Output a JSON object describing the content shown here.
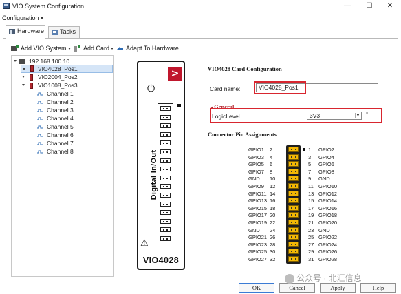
{
  "window": {
    "title": "VIO System Configuration",
    "minimize": "—",
    "maximize": "☐",
    "close": "✕"
  },
  "menu": {
    "configuration": "Configuration"
  },
  "tabs": [
    {
      "label": "Hardware"
    },
    {
      "label": "Tasks"
    }
  ],
  "toolbar": {
    "add_vio_system": "Add VIO System",
    "add_card": "Add Card",
    "adapt": "Adapt To Hardware..."
  },
  "tree": {
    "host": "192.168.100.10",
    "cards": [
      "VIO4028_Pos1",
      "VIO2004_Pos2",
      "VIO1008_Pos3"
    ],
    "channels": [
      "Channel 1",
      "Channel 2",
      "Channel 3",
      "Channel 4",
      "Channel 5",
      "Channel 6",
      "Channel 7",
      "Channel 8"
    ]
  },
  "card_graphic": {
    "label": "Digital In/Out",
    "model": "VIO4028",
    "logo": ">",
    "power": "⏻",
    "warning": "⚠"
  },
  "config": {
    "title": "VIO4028 Card Configuration",
    "card_name_label": "Card name:",
    "card_name_value": "VIO4028_Pos1",
    "general_title": "General",
    "logic_level_label": "LogicLevel",
    "logic_level_value": "3V3",
    "reset_glyph": "¤"
  },
  "pins": {
    "title": "Connector Pin Assignments",
    "rows": [
      {
        "left_name": "GPIO1",
        "left_num": "2",
        "right_num": "1",
        "right_name": "GPIO2"
      },
      {
        "left_name": "GPIO3",
        "left_num": "4",
        "right_num": "3",
        "right_name": "GPIO4"
      },
      {
        "left_name": "GPIO5",
        "left_num": "6",
        "right_num": "5",
        "right_name": "GPIO6"
      },
      {
        "left_name": "GPIO7",
        "left_num": "8",
        "right_num": "7",
        "right_name": "GPIO8"
      },
      {
        "left_name": "GND",
        "left_num": "10",
        "right_num": "9",
        "right_name": "GND"
      },
      {
        "left_name": "GPIO9",
        "left_num": "12",
        "right_num": "11",
        "right_name": "GPIO10"
      },
      {
        "left_name": "GPIO11",
        "left_num": "14",
        "right_num": "13",
        "right_name": "GPIO12"
      },
      {
        "left_name": "GPIO13",
        "left_num": "16",
        "right_num": "15",
        "right_name": "GPIO14"
      },
      {
        "left_name": "GPIO15",
        "left_num": "18",
        "right_num": "17",
        "right_name": "GPIO16"
      },
      {
        "left_name": "GPIO17",
        "left_num": "20",
        "right_num": "19",
        "right_name": "GPIO18"
      },
      {
        "left_name": "GPIO19",
        "left_num": "22",
        "right_num": "21",
        "right_name": "GPIO20"
      },
      {
        "left_name": "GND",
        "left_num": "24",
        "right_num": "23",
        "right_name": "GND"
      },
      {
        "left_name": "GPIO21",
        "left_num": "26",
        "right_num": "25",
        "right_name": "GPIO22"
      },
      {
        "left_name": "GPIO23",
        "left_num": "28",
        "right_num": "27",
        "right_name": "GPIO24"
      },
      {
        "left_name": "GPIO25",
        "left_num": "30",
        "right_num": "29",
        "right_name": "GPIO26"
      },
      {
        "left_name": "GPIO27",
        "left_num": "32",
        "right_num": "31",
        "right_name": "GPIO28"
      }
    ]
  },
  "buttons": {
    "ok": "OK",
    "cancel": "Cancel",
    "apply": "Apply",
    "help": "Help"
  },
  "watermark": "公众号 · 北汇信息",
  "colors": {
    "highlight": "#d8262f",
    "card_red": "#c0172d",
    "pin_gold": "#f2b705",
    "selection": "#d5e5f7"
  }
}
